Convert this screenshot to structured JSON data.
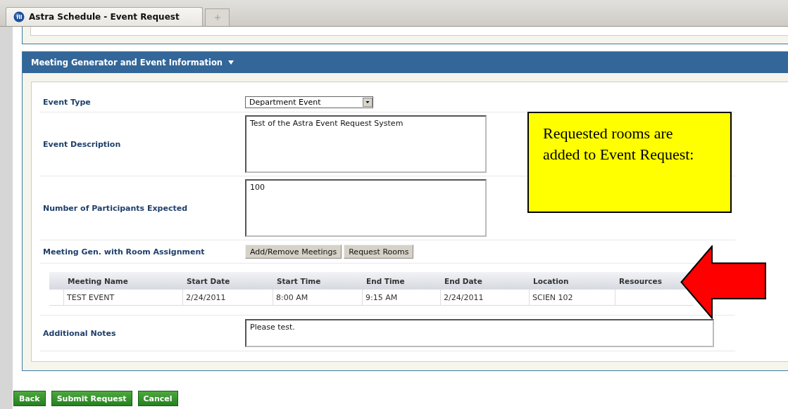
{
  "browser_tab": {
    "title": "Astra Schedule - Event Request"
  },
  "panel": {
    "title": "Meeting Generator and Event Information",
    "expanded": true
  },
  "form": [
    {
      "kind": "select",
      "label": "Event Type",
      "value": "Department Event"
    },
    {
      "kind": "textarea",
      "label": "Event Description",
      "value": "Test of the Astra Event Request System"
    },
    {
      "kind": "textarea",
      "label": "Number of Participants Expected",
      "value": "100"
    },
    {
      "kind": "buttons",
      "label": "Meeting Gen. with Room Assignment",
      "buttons": [
        "Add/Remove Meetings",
        "Request Rooms"
      ]
    },
    {
      "kind": "table",
      "columns": [
        "Meeting Name",
        "Start Date",
        "Start Time",
        "End Time",
        "End Date",
        "Location",
        "Resources"
      ],
      "rows": [
        [
          "TEST EVENT",
          "2/24/2011",
          "8:00 AM",
          "9:15 AM",
          "2/24/2011",
          "SCIEN 102",
          ""
        ]
      ]
    },
    {
      "kind": "note",
      "label": "Additional Notes",
      "value": "Please test."
    }
  ],
  "callout": {
    "text": "Requested rooms are added to Event Request:"
  },
  "actions": [
    "Back",
    "Submit Request",
    "Cancel"
  ]
}
